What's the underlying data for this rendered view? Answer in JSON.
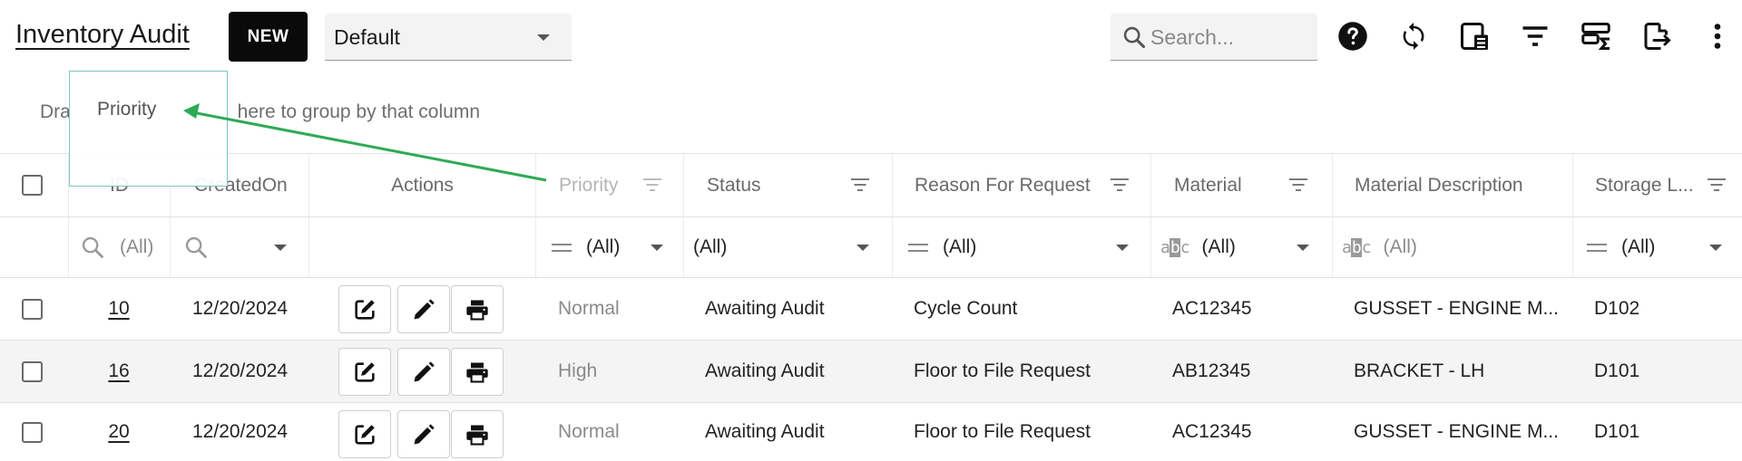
{
  "toolbar": {
    "title": "Inventory Audit",
    "new_label": "NEW",
    "view_selected": "Default",
    "search_placeholder": "Search...",
    "icons": [
      "help-icon",
      "refresh-icon",
      "column-chooser-icon",
      "filter-icon",
      "summary-icon",
      "export-icon",
      "more-vert-icon"
    ]
  },
  "group_panel": {
    "hint_start": "Dra",
    "hint_end": " here to group by that column",
    "drag_label": "Priority"
  },
  "grid": {
    "columns": [
      {
        "key": "id",
        "label": "ID"
      },
      {
        "key": "created_on",
        "label": "CreatedOn"
      },
      {
        "key": "actions",
        "label": "Actions"
      },
      {
        "key": "priority",
        "label": "Priority"
      },
      {
        "key": "status",
        "label": "Status"
      },
      {
        "key": "reason",
        "label": "Reason For Request"
      },
      {
        "key": "material",
        "label": "Material"
      },
      {
        "key": "material_desc",
        "label": "Material Description"
      },
      {
        "key": "storage",
        "label": "Storage L..."
      }
    ],
    "filters": {
      "id": "(All)",
      "priority": "(All)",
      "status": "(All)",
      "reason": "(All)",
      "material": "(All)",
      "material_desc": "(All)",
      "storage": "(All)"
    },
    "rows": [
      {
        "id": "10",
        "created_on": "12/20/2024",
        "priority": "Normal",
        "status": "Awaiting Audit",
        "reason": "Cycle Count",
        "material": "AC12345",
        "material_desc": "GUSSET - ENGINE M...",
        "storage": "D102"
      },
      {
        "id": "16",
        "created_on": "12/20/2024",
        "priority": "High",
        "status": "Awaiting Audit",
        "reason": "Floor to File Request",
        "material": "AB12345",
        "material_desc": "BRACKET - LH",
        "storage": "D101"
      },
      {
        "id": "20",
        "created_on": "12/20/2024",
        "priority": "Normal",
        "status": "Awaiting Audit",
        "reason": "Floor to File Request",
        "material": "AC12345",
        "material_desc": "GUSSET - ENGINE M...",
        "storage": "D101"
      }
    ]
  },
  "colors": {
    "primary_button": "#0a0a0a",
    "drag_arrow": "#2eaa55",
    "drag_border": "#7fc5c0"
  }
}
